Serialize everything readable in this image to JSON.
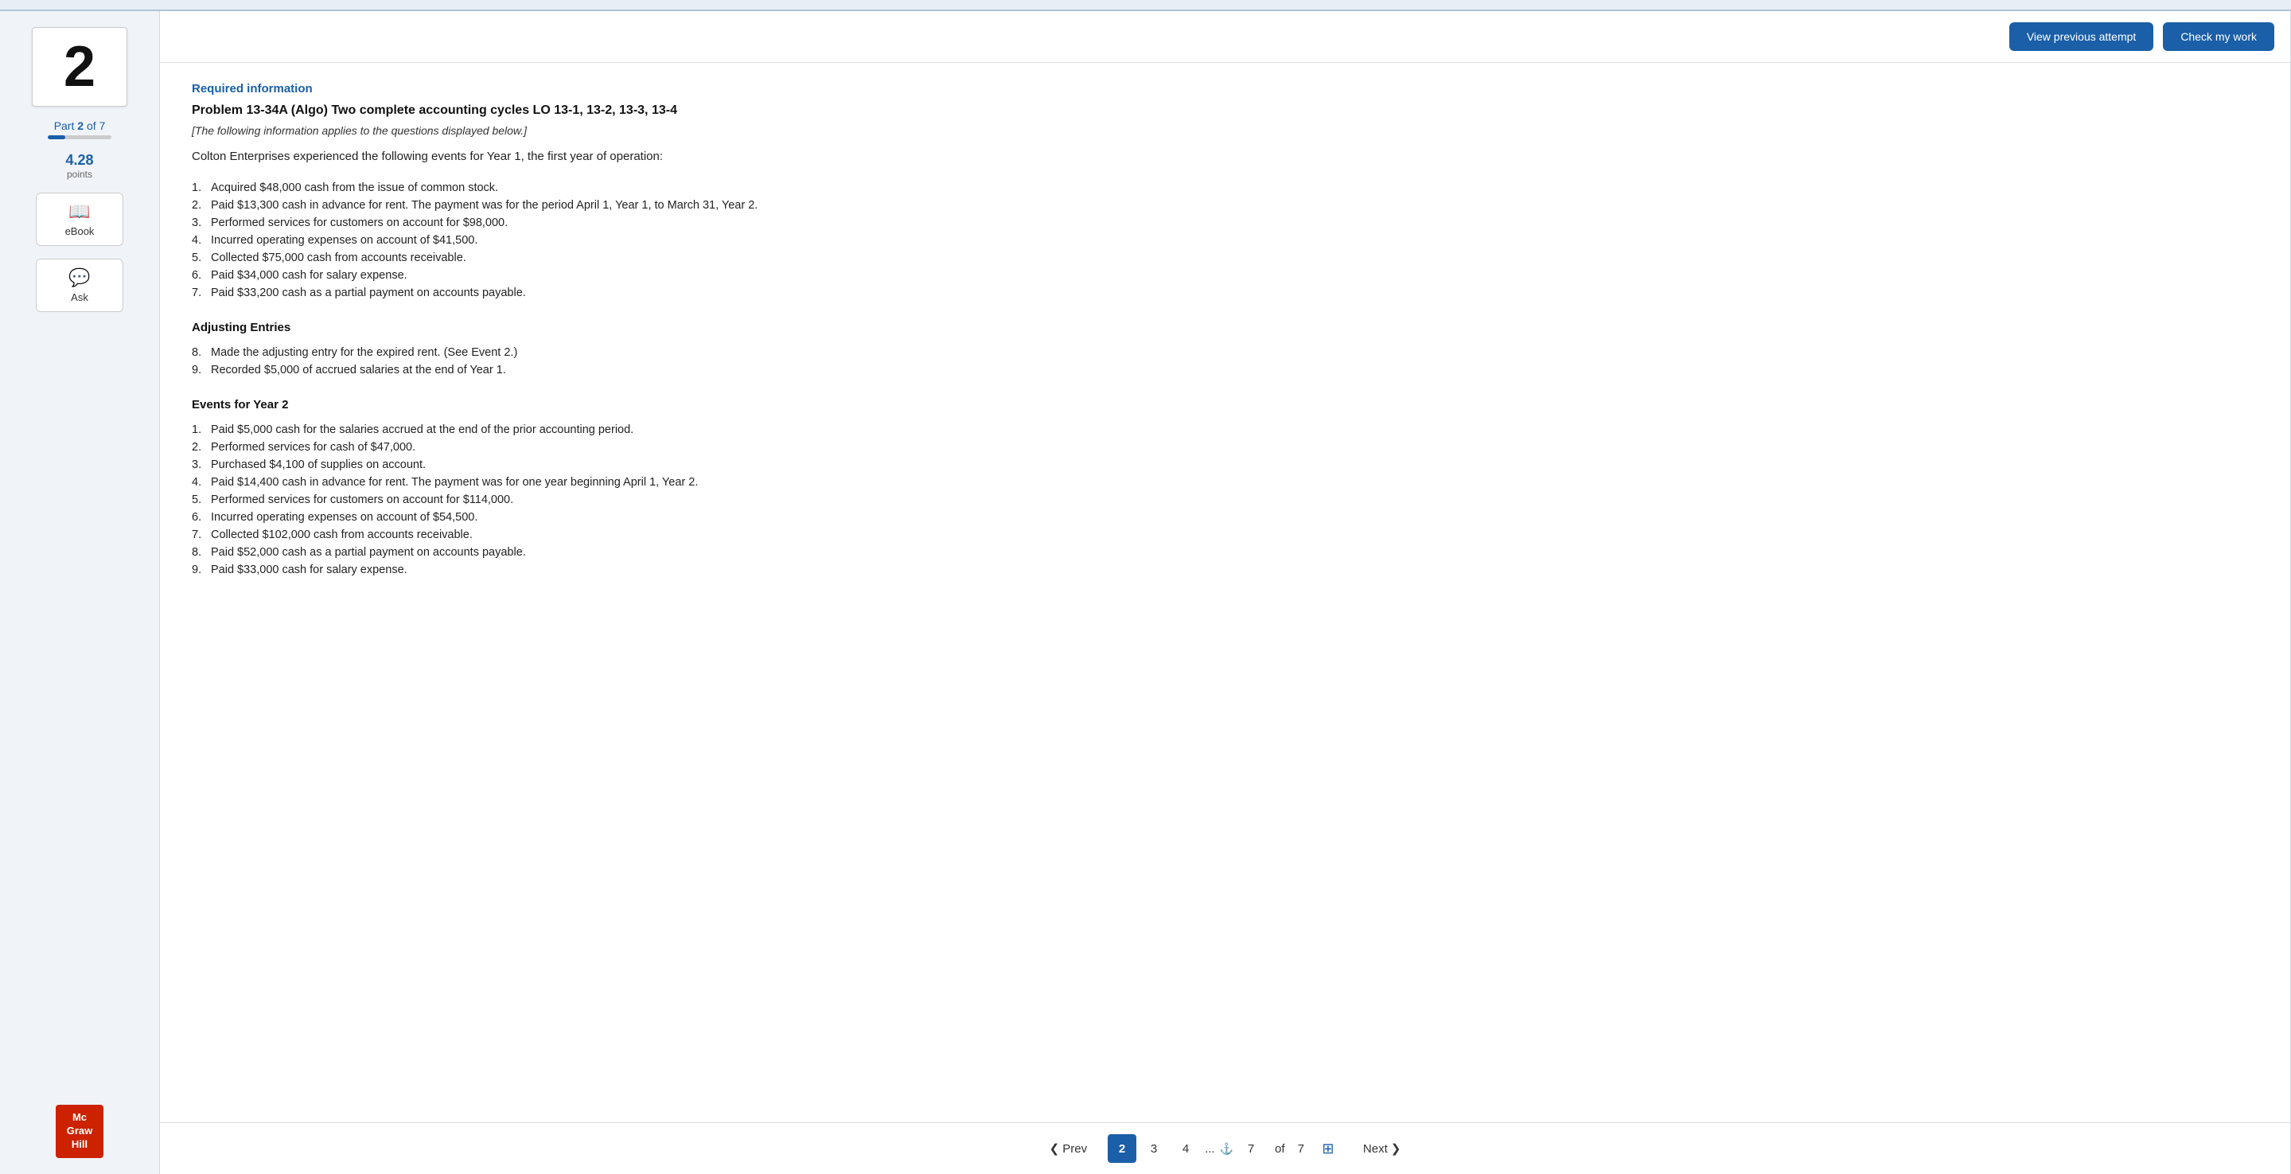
{
  "topBar": {},
  "sidebar": {
    "questionNumber": "2",
    "partLabel": "Part",
    "partNumber": "2",
    "partOf": "of 7",
    "progressPercent": 28,
    "points": "4.28",
    "pointsLabel": "points",
    "ebookLabel": "eBook",
    "askLabel": "Ask",
    "logoLine1": "Mc",
    "logoLine2": "Graw",
    "logoLine3": "Hill"
  },
  "header": {
    "viewPrevLabel": "View previous attempt",
    "checkWorkLabel": "Check my work"
  },
  "content": {
    "requiredInfo": "Required information",
    "problemTitle": "Problem 13-34A (Algo) Two complete accounting cycles LO 13-1, 13-2, 13-3, 13-4",
    "italicInfo": "[The following information applies to the questions displayed below.]",
    "introText": "Colton Enterprises experienced the following events for Year 1, the first year of operation:",
    "year1Events": [
      {
        "num": "1.",
        "text": "Acquired $48,000 cash from the issue of common stock."
      },
      {
        "num": "2.",
        "text": "Paid $13,300 cash in advance for rent. The payment was for the period April 1, Year 1, to March 31, Year 2."
      },
      {
        "num": "3.",
        "text": "Performed services for customers on account for $98,000."
      },
      {
        "num": "4.",
        "text": "Incurred operating expenses on account of $41,500."
      },
      {
        "num": "5.",
        "text": "Collected $75,000 cash from accounts receivable."
      },
      {
        "num": "6.",
        "text": "Paid $34,000 cash for salary expense."
      },
      {
        "num": "7.",
        "text": "Paid $33,200 cash as a partial payment on accounts payable."
      }
    ],
    "adjustingEntriesHeading": "Adjusting Entries",
    "adjustingEvents": [
      {
        "num": "8.",
        "text": "Made the adjusting entry for the expired rent. (See Event 2.)"
      },
      {
        "num": "9.",
        "text": "Recorded $5,000 of accrued salaries at the end of Year 1."
      }
    ],
    "year2Heading": "Events for Year 2",
    "year2Events": [
      {
        "num": "1.",
        "text": "Paid $5,000 cash for the salaries accrued at the end of the prior accounting period."
      },
      {
        "num": "2.",
        "text": "Performed services for cash of $47,000."
      },
      {
        "num": "3.",
        "text": "Purchased $4,100 of supplies on account."
      },
      {
        "num": "4.",
        "text": "Paid $14,400 cash in advance for rent. The payment was for one year beginning April 1, Year 2."
      },
      {
        "num": "5.",
        "text": "Performed services for customers on account for $114,000."
      },
      {
        "num": "6.",
        "text": "Incurred operating expenses on account of $54,500."
      },
      {
        "num": "7.",
        "text": "Collected $102,000 cash from accounts receivable."
      },
      {
        "num": "8.",
        "text": "Paid $52,000 cash as a partial payment on accounts payable."
      },
      {
        "num": "9.",
        "text": "Paid $33,000 cash for salary expense."
      }
    ]
  },
  "pagination": {
    "prevLabel": "Prev",
    "nextLabel": "Next",
    "pages": [
      "2",
      "3",
      "4",
      "...",
      "7"
    ],
    "activePage": "2",
    "ofLabel": "of",
    "totalPages": "7"
  }
}
